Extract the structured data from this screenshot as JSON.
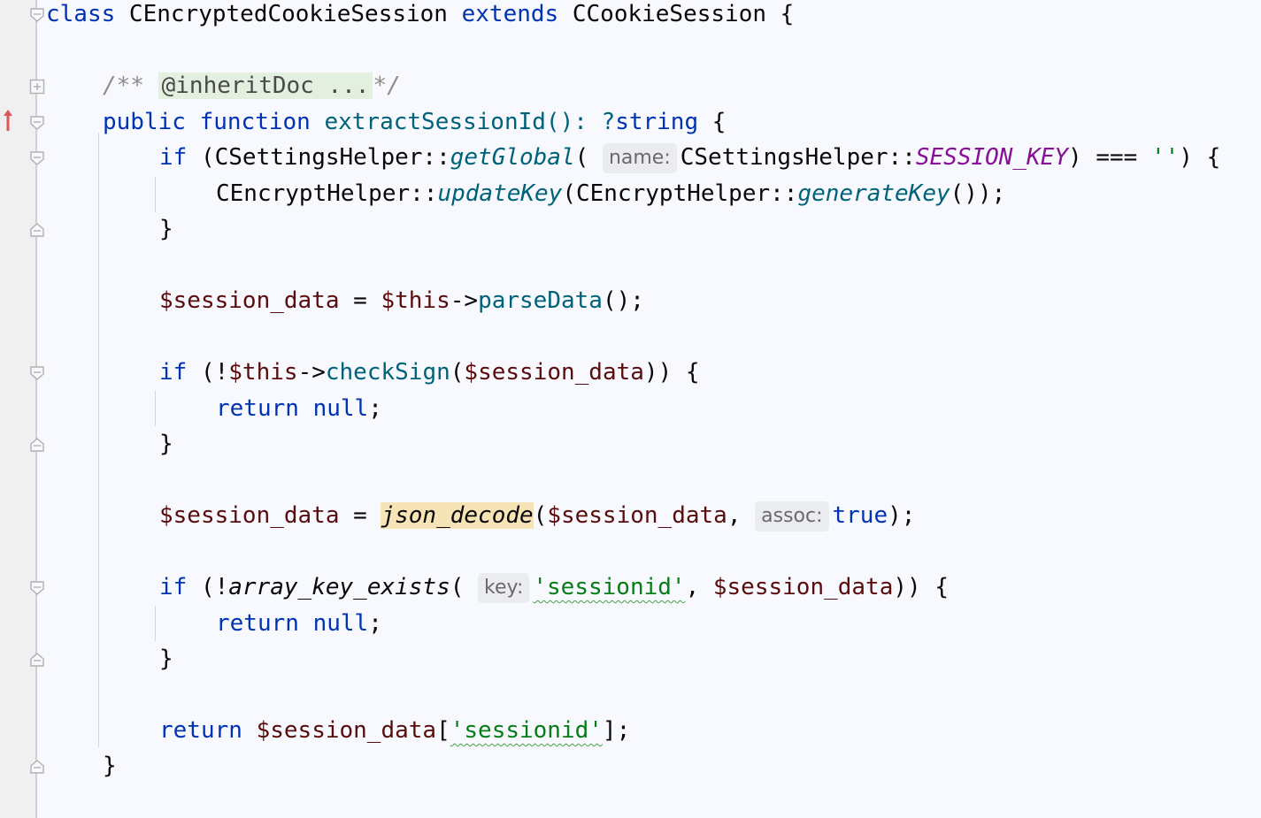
{
  "editor": {
    "language": "PHP",
    "colors": {
      "background": "#f7f9fe",
      "keyword": "#0033b3",
      "function": "#00627a",
      "string": "#067d17",
      "constant": "#871094",
      "variable": "#5a0c0c",
      "comment": "#8c8c8c"
    }
  },
  "code": {
    "l1": {
      "kw_class": "class",
      "class_name": " CEncryptedCookieSession ",
      "kw_extends": "extends",
      "parent": " CCookieSession {"
    },
    "l3": {
      "open": "/** ",
      "tag": "@inheritDoc ...",
      "close": "*/"
    },
    "l4": {
      "kw_public": "public",
      "kw_function": "function",
      "name": " extractSessionId(): ?",
      "ret_type": "string",
      "brace": " {"
    },
    "l5": {
      "kw_if": "if",
      "open": " (CSettingsHelper::",
      "fn": "getGlobal",
      "paren": "( ",
      "hint": "name:",
      "cls": "CSettingsHelper::",
      "const": "SESSION_KEY",
      "cmp": ") === ",
      "str": "''",
      "close": ") {"
    },
    "l6": {
      "cls": "CEncryptHelper::",
      "fn1": "updateKey",
      "mid": "(CEncryptHelper::",
      "fn2": "generateKey",
      "close": "());"
    },
    "l7": {
      "brace": "}"
    },
    "l9": {
      "var": "$session_data",
      "eq": " = ",
      "this": "$this",
      "arrow": "->",
      "fn": "parseData",
      "close": "();"
    },
    "l11": {
      "kw_if": "if",
      "open": " (!",
      "this": "$this",
      "arrow": "->",
      "fn": "checkSign",
      "paren": "(",
      "var": "$session_data",
      "close": ")) {"
    },
    "l12": {
      "kw_return": "return",
      "kw_null": "null",
      "semi": ";"
    },
    "l13": {
      "brace": "}"
    },
    "l15": {
      "var": "$session_data",
      "eq": " = ",
      "fn": "json_decode",
      "paren": "(",
      "arg": "$session_data",
      "comma": ", ",
      "hint": "assoc:",
      "kw_true": "true",
      "close": ");"
    },
    "l17": {
      "kw_if": "if",
      "open": " (!",
      "fn": "array_key_exists",
      "paren": "( ",
      "hint": "key:",
      "str": "'sessionid'",
      "comma": ", ",
      "var": "$session_data",
      "close": ")) {"
    },
    "l18": {
      "kw_return": "return",
      "kw_null": "null",
      "semi": ";"
    },
    "l19": {
      "brace": "}"
    },
    "l21": {
      "kw_return": "return",
      "var": "$session_data",
      "open": "[",
      "str": "'sessionid'",
      "close": "];"
    },
    "l22": {
      "brace": "}"
    }
  },
  "gutter": {
    "override_marker": "overridden-method-icon",
    "fold_icons": [
      "fold-collapse-icon",
      "fold-expand-icon",
      "fold-end-icon"
    ]
  }
}
